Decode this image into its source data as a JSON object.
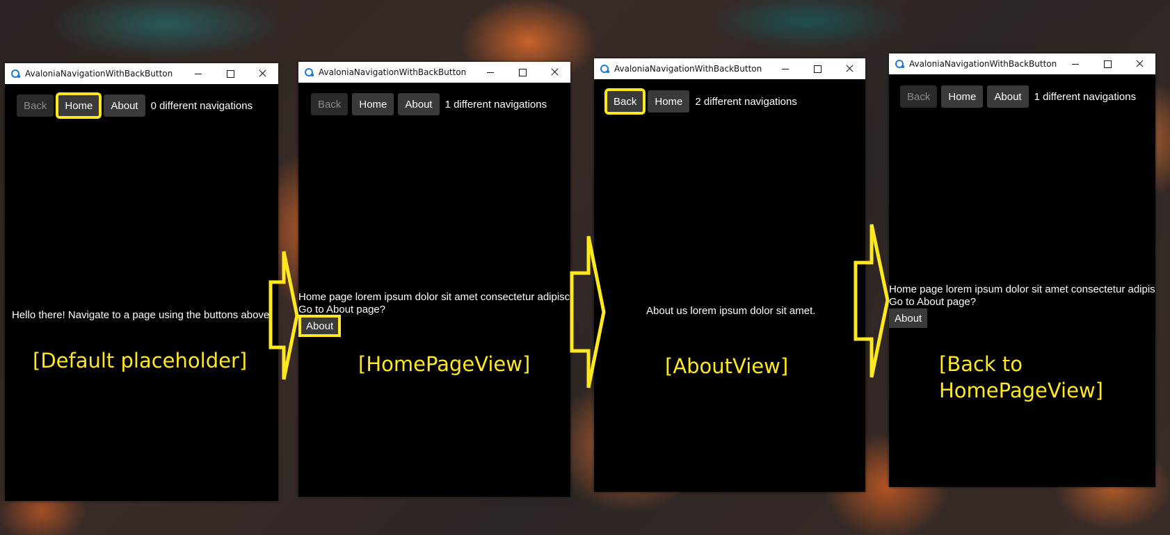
{
  "window_title": "AvaloniaNavigationWithBackButton",
  "buttons": {
    "back": "Back",
    "home": "Home",
    "about": "About"
  },
  "panels": [
    {
      "nav_count": "0 different navigations",
      "line1": "Hello there! Navigate to a page using the buttons above.",
      "caption": "[Default placeholder]"
    },
    {
      "nav_count": "1 different navigations",
      "line1": "Home page lorem ipsum dolor sit amet consectetur adipiscing",
      "line2": "Go to About page?",
      "inner_button": "About",
      "caption": "[HomePageView]"
    },
    {
      "nav_count": "2 different navigations",
      "line1": "About us lorem ipsum dolor sit amet.",
      "caption": "[AboutView]"
    },
    {
      "nav_count": "1 different navigations",
      "line1": "Home page lorem ipsum dolor sit amet consectetur adipiscing",
      "line2": "Go to About page?",
      "inner_button": "About",
      "caption_line1": "[Back to",
      "caption_line2": "HomePageView]"
    }
  ],
  "colors": {
    "highlight": "#ffe81f",
    "window_bg": "#000000",
    "button_bg": "#3a3a3a"
  }
}
